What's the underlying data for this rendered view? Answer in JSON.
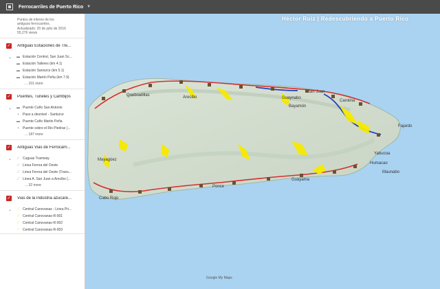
{
  "app": {
    "title": "Ferrocarriles de Puerto Rico"
  },
  "header": {
    "banner": "Héctor Ruiz | Redescubriendo a Puerto Rico"
  },
  "info": {
    "description_1": "Puntos de interes de los",
    "description_2": "antiguos ferrocarriles.",
    "updated": "Actualizado: 20 de julio de 2016",
    "views": "55,276 views"
  },
  "sidebar": {
    "sections": [
      {
        "title": "Antiguas Estaciones de Tre...",
        "items": [
          "Estación Central, San Juan Sc...",
          "Estación Talleres (km 4.1)",
          "Estación Santurce (km 5.1)",
          "Estación Martín Peña (km 7.9)"
        ],
        "more": "... 101 more"
      },
      {
        "title": "Puentes, Tuneles y Cambijos",
        "items": [
          "Puente Caño San Antonio",
          "Paso a desnivel - Santurce",
          "Puente Caño Martin Peña",
          "Puente sobre el Rio Piedras (..."
        ],
        "more": "... 187 more"
      },
      {
        "title": "Antiguas Vias de Ferrocarri...",
        "items": [
          "Cuguas Tramway",
          "Linea Ferrea del Oeste",
          "Linea Ferrea del Oeste (Trans...",
          "Linea A. San Juan a Arecibo (..."
        ],
        "more": "... 32 more"
      },
      {
        "title": "Vias de la Industria azucare...",
        "items": [
          "Central Canovanas - Linea Pri...",
          "Central Canovanas-R-001",
          "Central Canovanas-R-002",
          "Central Canovanas-R-003"
        ],
        "more": ""
      }
    ]
  },
  "map": {
    "places": [
      "San Juan",
      "Bayamón",
      "Carolina",
      "Quebradillas",
      "Guaynabo",
      "Humacao",
      "Mayagüez",
      "Ponce",
      "Guayama",
      "Maunabo",
      "Arecibo",
      "Cabo Rojo",
      "Yabucoa",
      "Fajardo"
    ],
    "footer": "Google My Maps"
  },
  "colors": {
    "accent": "#c62828",
    "rail_red": "#d32f2f",
    "rail_blue": "#1e3fbf",
    "sugar_yellow": "#f6ea00"
  }
}
